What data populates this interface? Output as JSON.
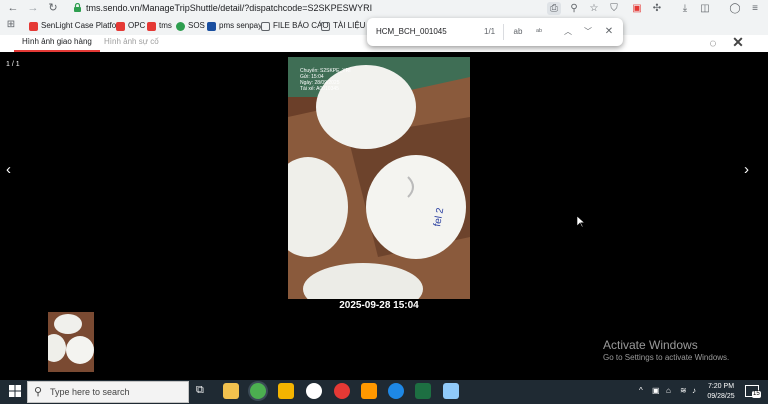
{
  "browser": {
    "url": "tms.sendo.vn/ManageTripShuttle/detail/?dispatchcode=S2SKPESWYRI",
    "bookmarks": [
      {
        "label": "SenLight Case Platfor...",
        "color": "#e53935"
      },
      {
        "label": "OPC",
        "color": "#e53935"
      },
      {
        "label": "tms",
        "color": "#e53935"
      },
      {
        "label": "SOS",
        "color": "#2e9e4f"
      },
      {
        "label": "pms senpay",
        "color": "#1a4fa0"
      },
      {
        "label": "FILE BÁO CÁO",
        "color": "folder"
      },
      {
        "label": "TÀI LIỆU",
        "color": "folder"
      }
    ]
  },
  "find_bar": {
    "query": "HCM_BCH_001045",
    "count": "1/1",
    "match_case_label": "ab"
  },
  "page": {
    "tabs": [
      "Hình ảnh giao hàng",
      "Hình ảnh sự cố"
    ],
    "counter": "1 / 1",
    "photo_caption": "2025-09-28 15:04",
    "photo_stamp": [
      "Chuyến: S2SKPE_YRI",
      "Gửi: 15:04",
      "Ngày: 28/09/2025",
      "Tài xế: A0010345"
    ]
  },
  "watermark": {
    "title": "Activate Windows",
    "subtitle": "Go to Settings to activate Windows."
  },
  "taskbar": {
    "search_placeholder": "Type here to search",
    "time": "7:20 PM",
    "date": "09/28/25",
    "notification_count": "15"
  },
  "colors": {
    "accent_tab": "#e53935",
    "taskbar": "#1f2a33",
    "viewer_bg": "#000000"
  }
}
